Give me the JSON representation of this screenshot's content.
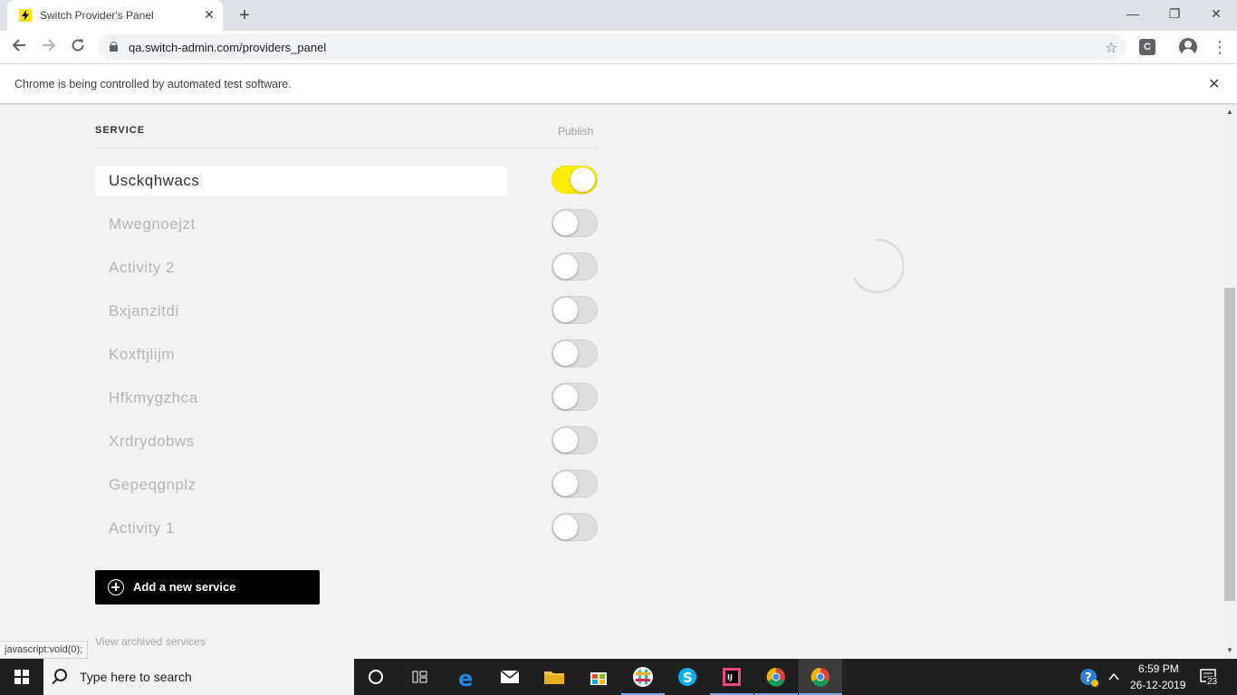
{
  "browser": {
    "tab_title": "Switch Provider's Panel",
    "tab_close": "✕",
    "new_tab": "+",
    "window_buttons": {
      "minimize": "—",
      "restore": "❐",
      "close": "✕"
    },
    "url": "qa.switch-admin.com/providers_panel",
    "extension_label": "C",
    "infobar_text": "Chrome is being controlled by automated test software.",
    "infobar_close": "✕"
  },
  "page": {
    "column_service": "SERVICE",
    "column_publish": "Publish",
    "services": [
      {
        "name": "Usckqhwacs",
        "published": true
      },
      {
        "name": "Mwegnoejzt",
        "published": false
      },
      {
        "name": "Activity 2",
        "published": false
      },
      {
        "name": "Bxjanzitdi",
        "published": false
      },
      {
        "name": "Koxftjlijm",
        "published": false
      },
      {
        "name": "Hfkmygzhca",
        "published": false
      },
      {
        "name": "Xrdrydobws",
        "published": false
      },
      {
        "name": "Gepeqgnplz",
        "published": false
      },
      {
        "name": "Activity 1",
        "published": false
      }
    ],
    "add_button_label": "Add a new service",
    "archived_link": "View archived services",
    "status_bar_url": "javascript:void(0);"
  },
  "taskbar": {
    "search_placeholder": "Type here to search",
    "time": "6:59 PM",
    "date": "26-12-2019",
    "notification_count": "23"
  },
  "colors": {
    "toggle_on": "#ffee00",
    "toggle_off": "#dedede",
    "add_button_bg": "#000000",
    "favicon_bg": "#ffe600"
  }
}
